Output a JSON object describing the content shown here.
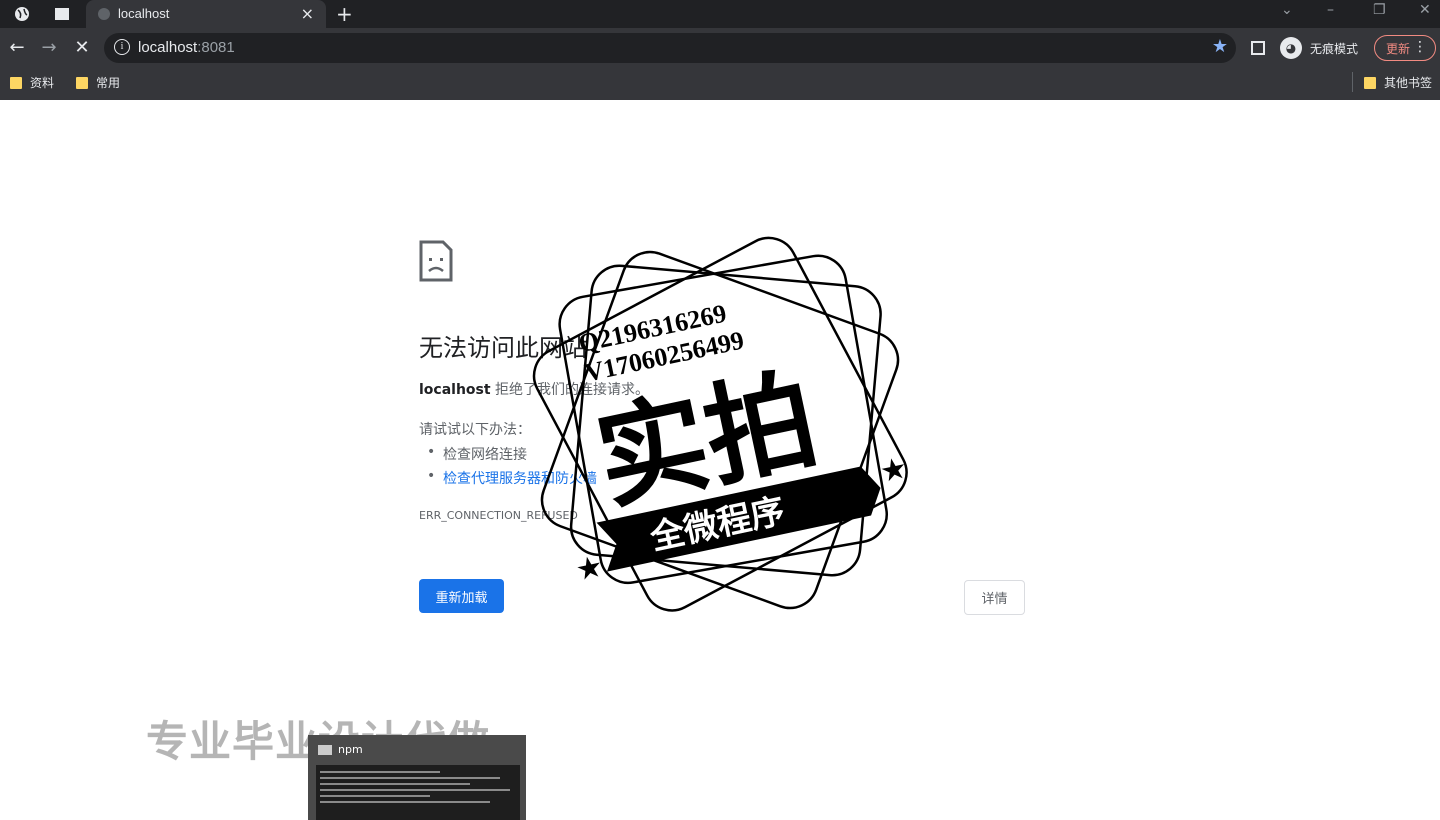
{
  "browser": {
    "tab_title": "localhost",
    "url_host": "localhost",
    "url_port": ":8081",
    "incognito_label": "无痕模式",
    "update_label": "更新",
    "bookmarks": [
      "资料",
      "常用"
    ],
    "other_bookmarks": "其他书签"
  },
  "error_page": {
    "title": "无法访问此网站",
    "host": "localhost",
    "message": " 拒绝了我们的连接请求。",
    "try_label": "请试试以下办法：",
    "suggestions": [
      "检查网络连接",
      "检查代理服务器和防火墙"
    ],
    "error_code": "ERR_CONNECTION_REFUSED",
    "reload_button": "重新加载",
    "details_button": "详情"
  },
  "watermark": {
    "contact_q": "Q2196316269",
    "contact_v": "V17060256499",
    "stamp_main": "实拍",
    "stamp_banner": "全微程序",
    "overlay_text": "专业毕业设计代做"
  },
  "taskbar_thumb": {
    "title": "npm"
  }
}
